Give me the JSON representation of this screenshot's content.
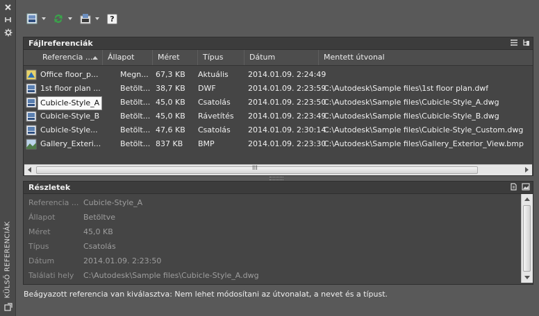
{
  "sidebar": {
    "title": "KÜLSŐ REFERENCIÁK",
    "close_icon": "close-icon",
    "autohide_icon": "autohide-icon",
    "properties_icon": "properties-icon"
  },
  "toolbar": {
    "attach_icon": "attach-dwg-icon",
    "refresh_icon": "refresh-icon",
    "change_path_icon": "change-path-icon",
    "help_icon": "help-icon",
    "help_glyph": "?"
  },
  "file_refs": {
    "title": "Fájlreferenciák",
    "columns": [
      "Referencia ...",
      "Állapot",
      "Méret",
      "Típus",
      "Dátum",
      "Mentett útvonal"
    ],
    "rows": [
      {
        "name": "Office floor_p...",
        "status": "Megn...",
        "size": "67,3 KB",
        "type": "Aktuális",
        "date": "2014.01.09. 2:24:49",
        "path": ""
      },
      {
        "name": "1st floor plan ...",
        "status": "Betölt...",
        "size": "38,7 KB",
        "type": "DWF",
        "date": "2014.01.09. 2:23:59",
        "path": "C:\\Autodesk\\Sample files\\1st floor plan.dwf"
      },
      {
        "name": "Cubicle-Style_A",
        "status": "Betölt...",
        "size": "45,0 KB",
        "type": "Csatolás",
        "date": "2014.01.09. 2:23:50",
        "path": "C:\\Autodesk\\Sample files\\Cubicle-Style_A.dwg"
      },
      {
        "name": "Cubicle-Style_B",
        "status": "Betölt...",
        "size": "45,0 KB",
        "type": "Rávetítés",
        "date": "2014.01.09. 2:23:49",
        "path": "C:\\Autodesk\\Sample files\\Cubicle-Style_B.dwg"
      },
      {
        "name": "Cubicle-Style...",
        "status": "Betölt...",
        "size": "47,6 KB",
        "type": "Csatolás",
        "date": "2014.01.09. 2:30:14",
        "path": "C:\\Autodesk\\Sample files\\Cubicle-Style_Custom.dwg"
      },
      {
        "name": "Gallery_Exteri...",
        "status": "Betölt...",
        "size": "837 KB",
        "type": "BMP",
        "date": "2014.01.09. 2:23:30",
        "path": "C:\\Autodesk\\Sample files\\Gallery_Exterior_View.bmp"
      }
    ],
    "scroll_grip": "III"
  },
  "details": {
    "title": "Részletek",
    "rows": [
      {
        "label": "Referencia ...",
        "value": "Cubicle-Style_A"
      },
      {
        "label": "Állapot",
        "value": "Betöltve"
      },
      {
        "label": "Méret",
        "value": "45,0 KB"
      },
      {
        "label": "Típus",
        "value": "Csatolás"
      },
      {
        "label": "Dátum",
        "value": "2014.01.09. 2:23:50"
      },
      {
        "label": "Találati hely",
        "value": "C:\\Autodesk\\Sample files\\Cubicle-Style_A.dwg"
      }
    ]
  },
  "status_message": "Beágyazott referencia van kiválasztva: Nem lehet módosítani az útvonalat, a nevet és a típust.",
  "colors": {
    "background": "#595959",
    "panel": "#454545",
    "header": "#3c3c3c",
    "selected_bg": "#fafafa",
    "refresh_green": "#3aa34a"
  }
}
